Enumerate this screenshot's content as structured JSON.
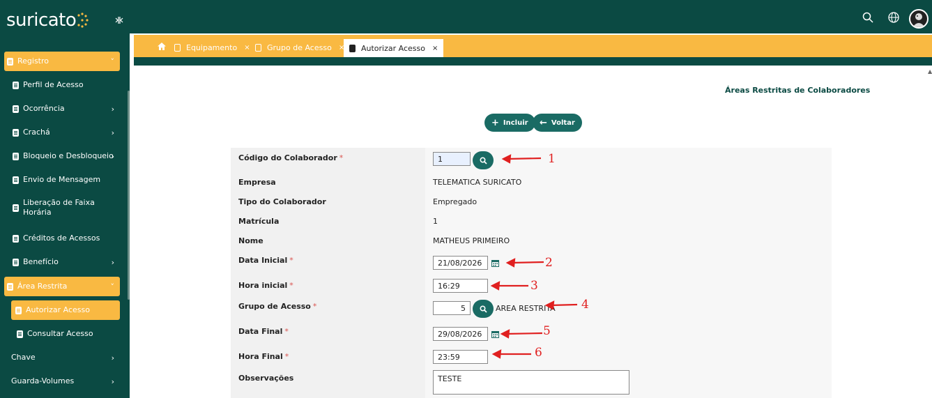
{
  "app": {
    "logo": "suricato"
  },
  "sidebar": {
    "items": [
      {
        "label": "Registro",
        "chev": "˅",
        "kind": "group-active"
      },
      {
        "label": "Perfil de Acesso",
        "chev": "",
        "kind": "item"
      },
      {
        "label": "Ocorrência",
        "chev": "›",
        "kind": "item"
      },
      {
        "label": "Crachá",
        "chev": "›",
        "kind": "item"
      },
      {
        "label": "Bloqueio e Desbloqueio",
        "chev": "›",
        "kind": "item"
      },
      {
        "label": "Envio de Mensagem",
        "chev": "",
        "kind": "item"
      },
      {
        "label": "Liberação de Faixa Horária",
        "chev": "",
        "kind": "item"
      },
      {
        "label": "Créditos de Acessos",
        "chev": "",
        "kind": "item"
      },
      {
        "label": "Benefício",
        "chev": "›",
        "kind": "item"
      },
      {
        "label": "Área Restrita",
        "chev": "˅",
        "kind": "group-active"
      },
      {
        "label": "Autorizar Acesso",
        "chev": "",
        "kind": "leaf-active"
      },
      {
        "label": "Consultar Acesso",
        "chev": "",
        "kind": "subitem"
      },
      {
        "label": "Chave",
        "chev": "›",
        "kind": "plain"
      },
      {
        "label": "Guarda-Volumes",
        "chev": "›",
        "kind": "plain"
      }
    ]
  },
  "tabs": [
    {
      "label": "Equipamento",
      "close": "×"
    },
    {
      "label": "Grupo de Acesso",
      "close": "×"
    },
    {
      "label": "Autorizar Acesso",
      "close": "×"
    }
  ],
  "page": {
    "title": "Áreas Restritas de Colaboradores",
    "add_label": "Incluir",
    "back_label": "Voltar"
  },
  "form": {
    "codigo_label": "Código do Colaborador",
    "codigo_value": "1",
    "empresa_label": "Empresa",
    "empresa_value": "TELEMATICA SURICATO",
    "tipo_label": "Tipo do Colaborador",
    "tipo_value": "Empregado",
    "matricula_label": "Matrícula",
    "matricula_value": "1",
    "nome_label": "Nome",
    "nome_value": "MATHEUS PRIMEIRO",
    "data_inicial_label": "Data Inicial",
    "data_inicial_value": "21/08/2026",
    "hora_inicial_label": "Hora inicial",
    "hora_inicial_value": "16:29",
    "grupo_label": "Grupo de Acesso",
    "grupo_value": "5",
    "grupo_desc": "AREA RESTRITA",
    "data_final_label": "Data Final",
    "data_final_value": "29/08/2026",
    "hora_final_label": "Hora Final",
    "hora_final_value": "23:59",
    "obs_label": "Observações",
    "obs_value": "TESTE",
    "required_mark": "*"
  },
  "annotations": [
    "1",
    "2",
    "3",
    "4",
    "5",
    "6"
  ],
  "colors": {
    "primary": "#0b4a43",
    "accent": "#f9b942",
    "button": "#1a6b64",
    "annotation": "#e02020"
  }
}
